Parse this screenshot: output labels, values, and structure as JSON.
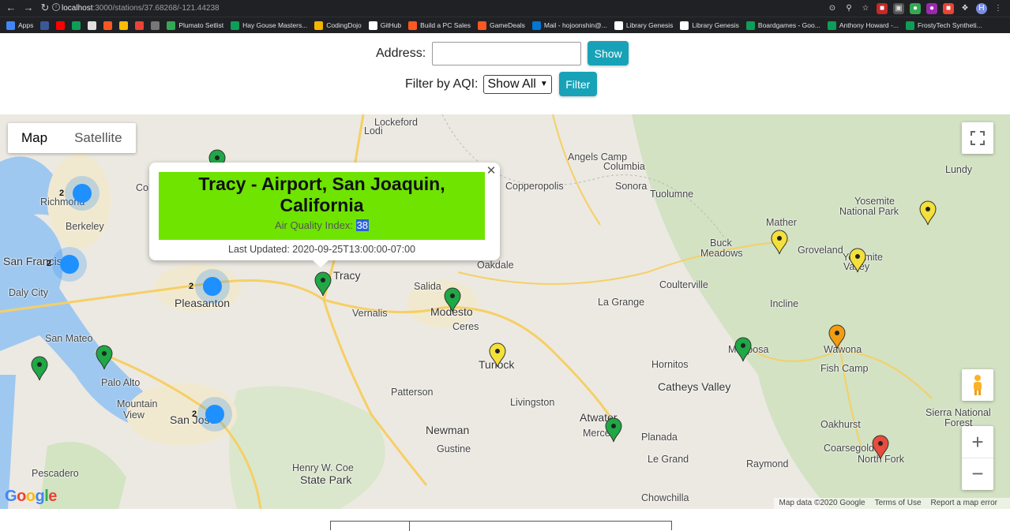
{
  "browser": {
    "url_host": "localhost",
    "url_path": ":3000/stations/37.68268/-121.44238",
    "bookmarks": [
      {
        "label": "Apps",
        "color": "#4285f4"
      },
      {
        "label": "",
        "color": "#3b5998"
      },
      {
        "label": "",
        "color": "#ff0000"
      },
      {
        "label": "",
        "color": "#0f9d58"
      },
      {
        "label": "",
        "color": "#e0e0e0"
      },
      {
        "label": "",
        "color": "#ff5722"
      },
      {
        "label": "",
        "color": "#fbbc04"
      },
      {
        "label": "",
        "color": "#ea4335"
      },
      {
        "label": "",
        "color": "#777777"
      },
      {
        "label": "Plumato Setlist",
        "color": "#34a853"
      },
      {
        "label": "Hay Gouse Masters...",
        "color": "#0f9d58"
      },
      {
        "label": "CodingDojo",
        "color": "#f4b400"
      },
      {
        "label": "GitHub",
        "color": "#ffffff"
      },
      {
        "label": "Build a PC Sales",
        "color": "#ff5722"
      },
      {
        "label": "GameDeals",
        "color": "#ff5722"
      },
      {
        "label": "Mail - hojoonshin@...",
        "color": "#0078d4"
      },
      {
        "label": "Library Genesis",
        "color": "#ffffff"
      },
      {
        "label": "Library Genesis",
        "color": "#ffffff"
      },
      {
        "label": "Boardgames - Goo...",
        "color": "#0f9d58"
      },
      {
        "label": "Anthony Howard -...",
        "color": "#0f9d58"
      },
      {
        "label": "FrostyTech Syntheti...",
        "color": "#0f9d58"
      }
    ]
  },
  "search": {
    "address_label": "Address:",
    "address_value": "",
    "show_button": "Show",
    "filter_label": "Filter by AQI:",
    "filter_selected": "Show All",
    "filter_button": "Filter"
  },
  "map": {
    "map_type_map": "Map",
    "map_type_satellite": "Satellite",
    "info": {
      "station": "Tracy - Airport, San Joaquin, California",
      "aqi_label": "Air Quality Index: ",
      "aqi_value": "38",
      "updated": "Last Updated: 2020-09-25T13:00:00-07:00"
    },
    "labels": [
      "Lockeford",
      "Lodi",
      "Angels Camp",
      "Columbia",
      "Copperopolis",
      "Sonora",
      "Tuolumne",
      "Lundy",
      "Mather",
      "Yosemite",
      "National Park",
      "Yosemite",
      "Valley",
      "Buck",
      "Meadows",
      "Groveland",
      "Oakdale",
      "Salida",
      "Modesto",
      "Ceres",
      "Coulterville",
      "La Grange",
      "Incline",
      "Wawona",
      "Fish Camp",
      "Mariposa",
      "Hornitos",
      "Catheys Valley",
      "Turlock",
      "Vernalis",
      "Patterson",
      "Livingston",
      "Atwater",
      "Merced",
      "Planada",
      "Le Grand",
      "Newman",
      "Gustine",
      "Chowchilla",
      "Raymond",
      "Coarsegold",
      "North Fork",
      "Oakhurst",
      "Sierra National",
      "Forest",
      "Richmond",
      "Berkeley",
      "San Francisco",
      "Daly City",
      "San Mateo",
      "Palo Alto",
      "Mountain",
      "View",
      "San Jose",
      "Pleasanton",
      "Pescadero",
      "Henry W. Coe",
      "State Park",
      "Tracy",
      "Colma"
    ],
    "clusters": [
      "2",
      "2",
      "2",
      "2"
    ],
    "marker_colors": {
      "good": "#1fa845",
      "moderate": "#f4e03a",
      "usg": "#f39c12",
      "unhealthy": "#e74c3c"
    },
    "attribution": [
      "Map data ©2020 Google",
      "Terms of Use",
      "Report a map error"
    ],
    "logo": "Google"
  }
}
